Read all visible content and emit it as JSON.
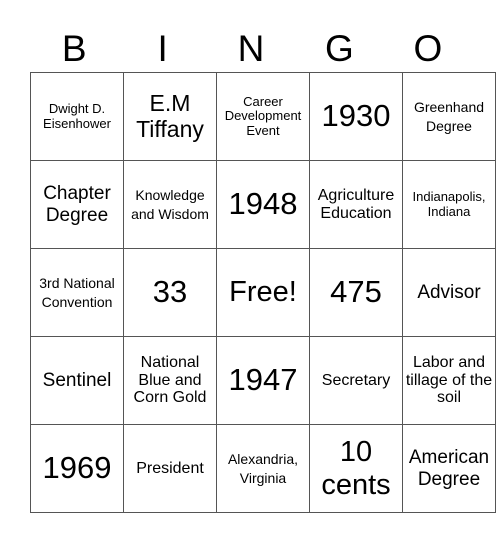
{
  "header": [
    "B",
    "I",
    "N",
    "G",
    "O"
  ],
  "board": [
    [
      "Dwight D. Eisenhower",
      "E.M Tiffany",
      "Career Development Event",
      "1930",
      "Greenhand Degree"
    ],
    [
      "Chapter Degree",
      "Knowledge and Wisdom",
      "1948",
      "Agriculture Education",
      "Indianapolis, Indiana"
    ],
    [
      "3rd National Convention",
      "33",
      "Free!",
      "475",
      "Advisor"
    ],
    [
      "Sentinel",
      "National Blue and Corn Gold",
      "1947",
      "Secretary",
      "Labor and tillage of the soil"
    ],
    [
      "1969",
      "President",
      "Alexandria, Virginia",
      "10 cents",
      "American Degree"
    ]
  ]
}
